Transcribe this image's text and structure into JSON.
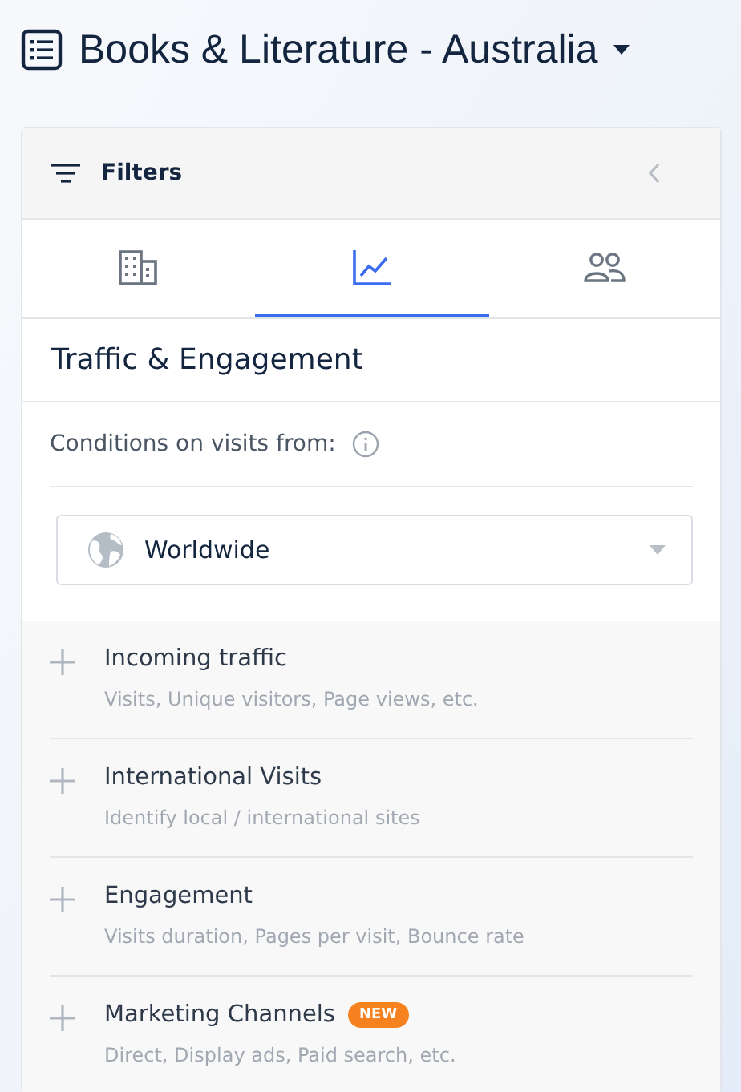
{
  "page": {
    "title": "Books & Literature - Australia"
  },
  "filters": {
    "title": "Filters"
  },
  "tabs": [
    {
      "kind": "building",
      "selected": false
    },
    {
      "kind": "chart",
      "selected": true
    },
    {
      "kind": "people",
      "selected": false
    }
  ],
  "section": {
    "title": "Traffic & Engagement",
    "conditions_label": "Conditions on visits from:",
    "region": {
      "value": "Worldwide"
    }
  },
  "groups": [
    {
      "title": "Incoming traffic",
      "subtitle": "Visits, Unique visitors, Page views, etc."
    },
    {
      "title": "International Visits",
      "subtitle": "Identify local / international sites"
    },
    {
      "title": "Engagement",
      "subtitle": "Visits duration, Pages per visit, Bounce rate"
    },
    {
      "title": "Marketing Channels",
      "badge": "NEW",
      "subtitle": "Direct, Display ads, Paid search, etc."
    }
  ]
}
